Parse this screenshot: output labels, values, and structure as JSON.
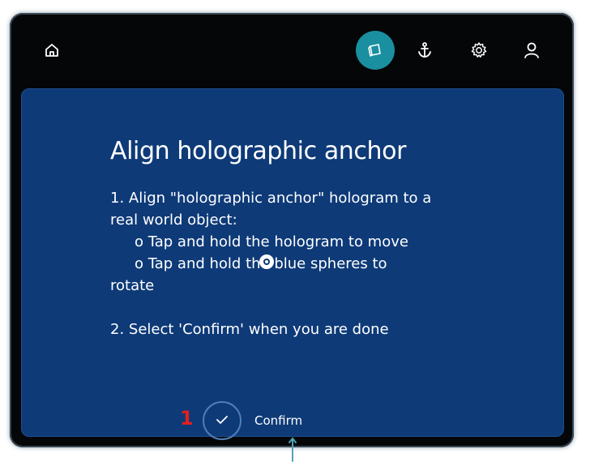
{
  "toolbar": {
    "icons": [
      "home-icon",
      "layers-icon",
      "anchor-icon",
      "gear-icon",
      "user-icon"
    ],
    "active_color": "#1a8fa0"
  },
  "panel": {
    "title": "Align holographic anchor",
    "instructions": {
      "step1_line1": "1. Align \"holographic anchor\" hologram to a",
      "step1_line2": "real world object:",
      "bullet1": "o Tap and hold the hologram to move",
      "bullet2": "o Tap and hold the blue spheres to",
      "bullet2_cont": "rotate",
      "step2": "2. Select 'Confirm' when you are done"
    },
    "step_number": "1",
    "confirm_label": "Confirm",
    "background_color": "#0e3a78"
  }
}
